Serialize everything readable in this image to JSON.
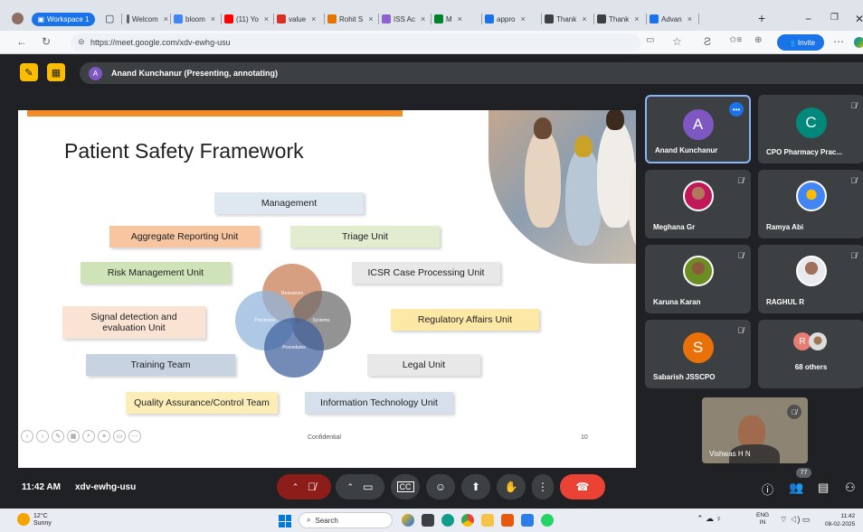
{
  "browser": {
    "workspace_label": "Workspace 1",
    "tabs": [
      {
        "label": "Welcom",
        "color": "#5f6368"
      },
      {
        "label": "bloom",
        "color": "#4285f4"
      },
      {
        "label": "(11) Yo",
        "color": "#ff0000"
      },
      {
        "label": "value",
        "color": "#d93025"
      },
      {
        "label": "Rohit S",
        "color": "#e37400"
      },
      {
        "label": "ISS Ac",
        "color": "#8e63ce"
      },
      {
        "label": "M",
        "color": "#00832d"
      },
      {
        "label": "appro",
        "color": "#1a73e8"
      },
      {
        "label": "Thank",
        "color": "#3c4043"
      },
      {
        "label": "Thank",
        "color": "#3c4043"
      },
      {
        "label": "Advan",
        "color": "#1a73e8"
      }
    ],
    "url": "https://meet.google.com/xdv-ewhg-usu",
    "invite_label": "Invite"
  },
  "meet": {
    "presenter": {
      "initial": "A",
      "label": "Anand Kunchanur (Presenting, annotating)"
    },
    "slide": {
      "title": "Patient Safety Framework",
      "boxes": [
        {
          "label": "Management",
          "color": "#dfe8f0"
        },
        {
          "label": "Aggregate Reporting Unit",
          "color": "#f7c59f"
        },
        {
          "label": "Triage Unit",
          "color": "#e2eccf"
        },
        {
          "label": "Risk Management Unit",
          "color": "#cfe3b8"
        },
        {
          "label": "ICSR Case Processing Unit",
          "color": "#e8e8e8"
        },
        {
          "label": "Signal detection and evaluation Unit",
          "color": "#fbe3d3"
        },
        {
          "label": "Regulatory Affairs Unit",
          "color": "#fde8a6"
        },
        {
          "label": "Training Team",
          "color": "#c7d3e0"
        },
        {
          "label": "Legal Unit",
          "color": "#e8e8e8"
        },
        {
          "label": "Quality Assurance/Control Team",
          "color": "#fdeeb8"
        },
        {
          "label": "Information Technology Unit",
          "color": "#d6e0ec"
        }
      ],
      "venn": [
        "Resources",
        "Systems",
        "Processes",
        "Procedures"
      ],
      "footer_center": "Confidential",
      "page_number": "10"
    },
    "participants": [
      {
        "name": "Anand Kunchanur",
        "initial": "A",
        "avatar_color": "#7e57c2",
        "kind": "initial"
      },
      {
        "name": "CPO Pharmacy Prac...",
        "initial": "C",
        "avatar_color": "#00897b",
        "kind": "initial"
      },
      {
        "name": "Meghana Gr",
        "kind": "photo"
      },
      {
        "name": "Ramya Abi",
        "kind": "photo"
      },
      {
        "name": "Karuna Karan",
        "kind": "photo"
      },
      {
        "name": "RAGHUL R",
        "kind": "photo"
      },
      {
        "name": "Sabarish JSSCPO",
        "initial": "S",
        "avatar_color": "#e8710a",
        "kind": "initial"
      },
      {
        "name": "68 others",
        "initial": "R",
        "avatar_color": "#e67c73",
        "kind": "others"
      }
    ],
    "self_view_name": "Vishwas H N",
    "controls": {
      "time": "11:42 AM",
      "meeting_code": "xdv-ewhg-usu",
      "people_count": "77"
    }
  },
  "taskbar": {
    "temperature": "12°C",
    "weather": "Sunny",
    "search_label": "Search",
    "lang_top": "ENG",
    "lang_bottom": "IN",
    "time": "11:42",
    "date": "08-02-2025"
  }
}
